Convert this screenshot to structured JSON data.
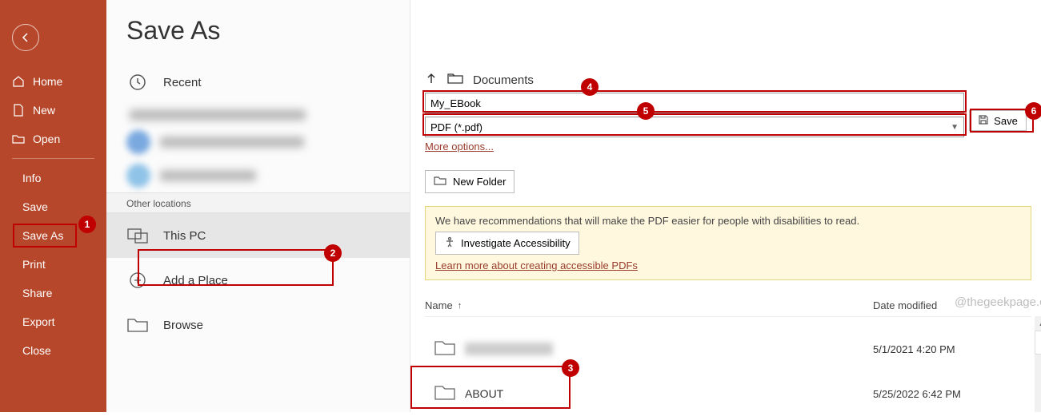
{
  "sidebar": {
    "home": "Home",
    "new": "New",
    "open": "Open",
    "info": "Info",
    "save": "Save",
    "save_as": "Save As",
    "print": "Print",
    "share": "Share",
    "export": "Export",
    "close": "Close"
  },
  "mid": {
    "title": "Save As",
    "recent": "Recent",
    "other_locations": "Other locations",
    "this_pc": "This PC",
    "add_place": "Add a Place",
    "browse": "Browse"
  },
  "main": {
    "breadcrumb_folder": "Documents",
    "filename": "My_EBook",
    "filetype": "PDF (*.pdf)",
    "more_options": "More options...",
    "save_label": "Save",
    "new_folder": "New Folder",
    "accessibility_msg": "We have recommendations that will make the PDF easier for people with disabilities to read.",
    "investigate_label": "Investigate Accessibility",
    "learn_link": "Learn more about creating accessible PDFs",
    "col_name": "Name",
    "col_date": "Date modified",
    "watermark": "@thegeekpage.com",
    "files": [
      {
        "name": "",
        "date": "5/1/2021 4:20 PM"
      },
      {
        "name": "ABOUT",
        "date": "5/25/2022 6:42 PM"
      }
    ]
  },
  "annotations": {
    "b1": "1",
    "b2": "2",
    "b3": "3",
    "b4": "4",
    "b5": "5",
    "b6": "6"
  }
}
